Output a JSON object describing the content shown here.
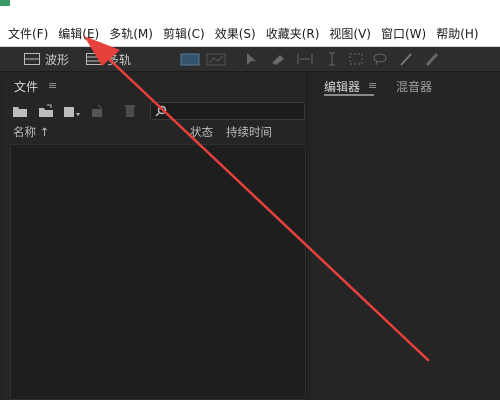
{
  "menu": {
    "items": [
      {
        "label": "文件(F)"
      },
      {
        "label": "编辑(E)"
      },
      {
        "label": "多轨(M)"
      },
      {
        "label": "剪辑(C)"
      },
      {
        "label": "效果(S)"
      },
      {
        "label": "收藏夹(R)"
      },
      {
        "label": "视图(V)"
      },
      {
        "label": "窗口(W)"
      },
      {
        "label": "帮助(H)"
      }
    ]
  },
  "toolbar": {
    "waveform_label": "波形",
    "multitrack_label": "多轨",
    "icons": [
      "waveform-view-icon",
      "spectral-view-icon",
      "move-tool-icon",
      "razor-tool-icon",
      "time-selection-icon",
      "marquee-tool-icon",
      "lasso-tool-icon",
      "brush-tool-icon",
      "spot-heal-icon"
    ]
  },
  "files_panel": {
    "title": "文件",
    "columns": {
      "name": "名称 ↑",
      "status": "状态",
      "duration": "持续时间"
    },
    "icons": [
      "open-folder-icon",
      "import-icon",
      "new-file-icon",
      "insert-icon",
      "delete-icon",
      "search-icon"
    ]
  },
  "editor_panel": {
    "tab_editor": "编辑器",
    "tab_mixer": "混音器"
  },
  "colors": {
    "annotation_arrow": "#e8413c",
    "app_background": "#232323",
    "menubar_background": "#ffffff"
  }
}
